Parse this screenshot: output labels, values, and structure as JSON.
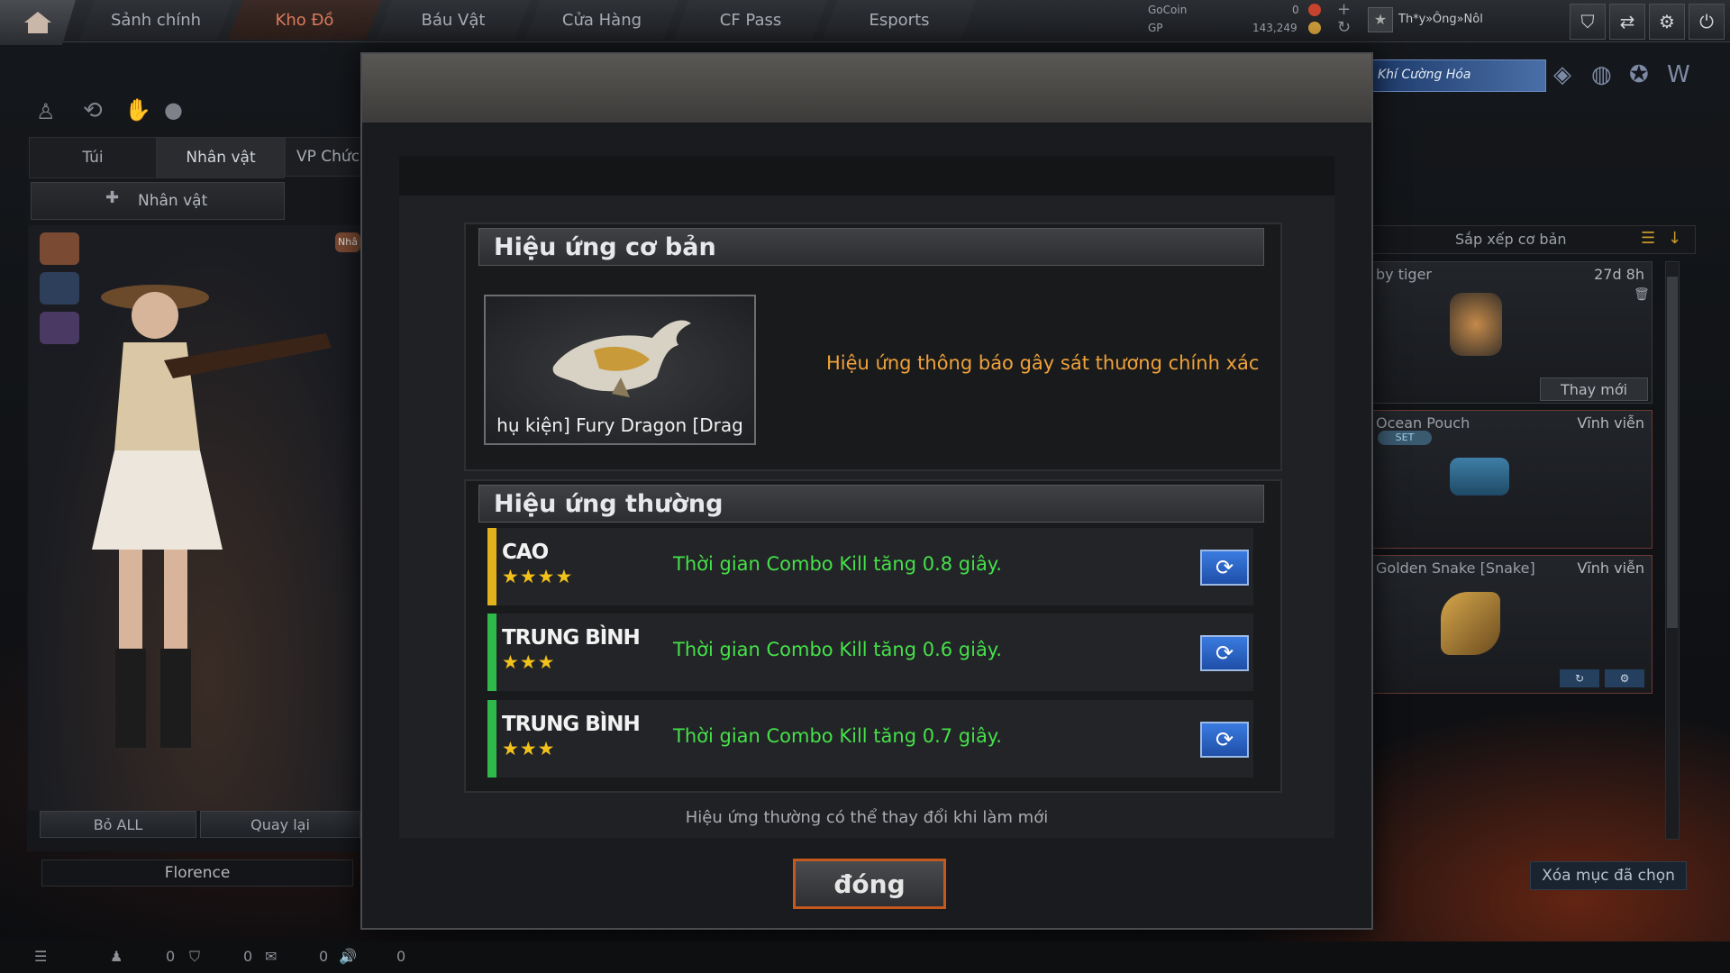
{
  "nav": {
    "tabs": [
      "Sảnh chính",
      "Kho Đồ",
      "Báu Vật",
      "Cửa Hàng",
      "CF Pass",
      "Esports"
    ],
    "active_index": 1
  },
  "currency": {
    "gocoin_label": "GoCoin",
    "gocoin_value": "0",
    "gp_label": "GP",
    "gp_value": "143,249"
  },
  "user": {
    "name": "Th*y»Ông»Nôl"
  },
  "banner": {
    "text": "Khí Cường Hóa"
  },
  "left": {
    "tabs": [
      "Túi",
      "Nhân vật",
      "VP Chức"
    ],
    "subtab": "Nhân vật",
    "remove_all": "Bỏ ALL",
    "back": "Quay lại",
    "character_name": "Florence",
    "badge": "Nhâ"
  },
  "right": {
    "sort_label": "Sắp xếp cơ bản",
    "cards": [
      {
        "title": "by tiger",
        "time": "27d 8h",
        "action": "Thay mới"
      },
      {
        "title": "Ocean Pouch",
        "time": "Vĩnh viễn",
        "tag": "SET"
      },
      {
        "title": "Golden Snake [Snake]",
        "time": "Vĩnh viễn"
      }
    ],
    "delete_selected": "Xóa mục đã chọn"
  },
  "modal": {
    "basic_title": "Hiệu ứng cơ bản",
    "item_name": "hụ kiện] Fury Dragon [Drag",
    "basic_effect": "Hiệu ứng thông báo gây sát thương chính xác",
    "normal_title": "Hiệu ứng thường",
    "effects": [
      {
        "grade": "CAO",
        "stars": "★★★★",
        "text": "Thời gian Combo Kill tăng 0.8 giây.",
        "bar_color": "#e2b21c"
      },
      {
        "grade": "TRUNG BÌNH",
        "stars": "★★★",
        "text": "Thời gian Combo Kill tăng 0.6 giây.",
        "bar_color": "#2fb94a"
      },
      {
        "grade": "TRUNG BÌNH",
        "stars": "★★★",
        "text": "Thời gian Combo Kill tăng 0.7 giây.",
        "bar_color": "#2fb94a"
      }
    ],
    "note": "Hiệu ứng thường có thể thay đổi khi làm mới",
    "close_label": "đóng"
  },
  "bottom": {
    "counts": [
      "0",
      "0",
      "0",
      "0"
    ]
  }
}
